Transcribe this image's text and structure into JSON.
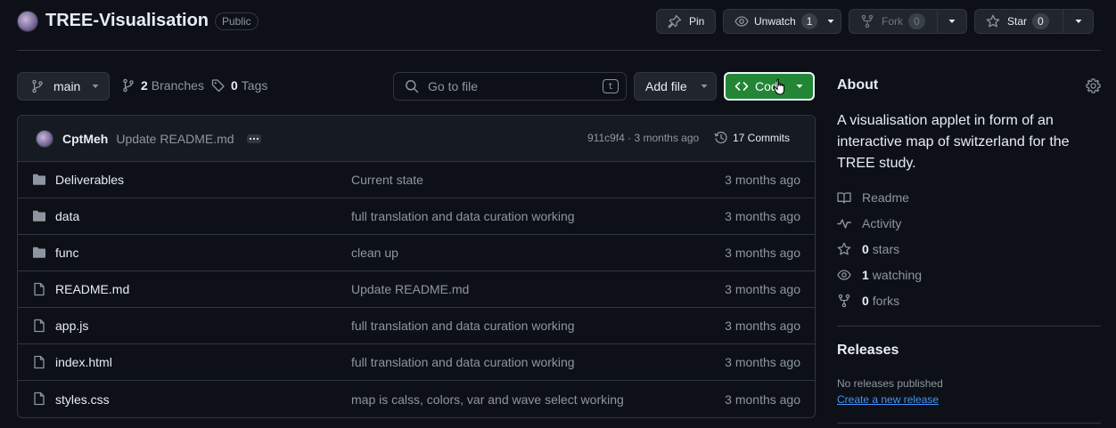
{
  "repo": {
    "name": "TREE-Visualisation",
    "visibility": "Public"
  },
  "header_actions": {
    "pin_label": "Pin",
    "unwatch_label": "Unwatch",
    "unwatch_count": "1",
    "fork_label": "Fork",
    "fork_count": "0",
    "star_label": "Star",
    "star_count": "0"
  },
  "toolbar": {
    "branch": "main",
    "branches_count": "2",
    "branches_label": "Branches",
    "tags_count": "0",
    "tags_label": "Tags",
    "search_placeholder": "Go to file",
    "search_shortcut": "t",
    "add_file_label": "Add file",
    "code_label": "Code"
  },
  "latest_commit": {
    "author": "CptMeh",
    "message": "Update README.md",
    "hash": "911c9f4",
    "time": "3 months ago",
    "separator": " · ",
    "commits_label": "17 Commits"
  },
  "files": [
    {
      "type": "dir",
      "name": "Deliverables",
      "message": "Current state",
      "date": "3 months ago"
    },
    {
      "type": "dir",
      "name": "data",
      "message": "full translation and data curation working",
      "date": "3 months ago"
    },
    {
      "type": "dir",
      "name": "func",
      "message": "clean up",
      "date": "3 months ago"
    },
    {
      "type": "file",
      "name": "README.md",
      "message": "Update README.md",
      "date": "3 months ago"
    },
    {
      "type": "file",
      "name": "app.js",
      "message": "full translation and data curation working",
      "date": "3 months ago"
    },
    {
      "type": "file",
      "name": "index.html",
      "message": "full translation and data curation working",
      "date": "3 months ago"
    },
    {
      "type": "file",
      "name": "styles.css",
      "message": "map is calss, colors, var and wave select working",
      "date": "3 months ago"
    }
  ],
  "about": {
    "title": "About",
    "description": "A visualisation applet in form of an interactive map of switzerland for the TREE study.",
    "readme_label": "Readme",
    "activity_label": "Activity",
    "stars_count": "0",
    "stars_label": "stars",
    "watching_count": "1",
    "watching_label": "watching",
    "forks_count": "0",
    "forks_label": "forks"
  },
  "releases": {
    "title": "Releases",
    "empty_text": "No releases published",
    "create_link": "Create a new release"
  },
  "colors": {
    "background": "#0d1117",
    "border": "#30363d",
    "code_button": "#238636",
    "link": "#4493f8",
    "muted_text": "#8d96a0"
  }
}
